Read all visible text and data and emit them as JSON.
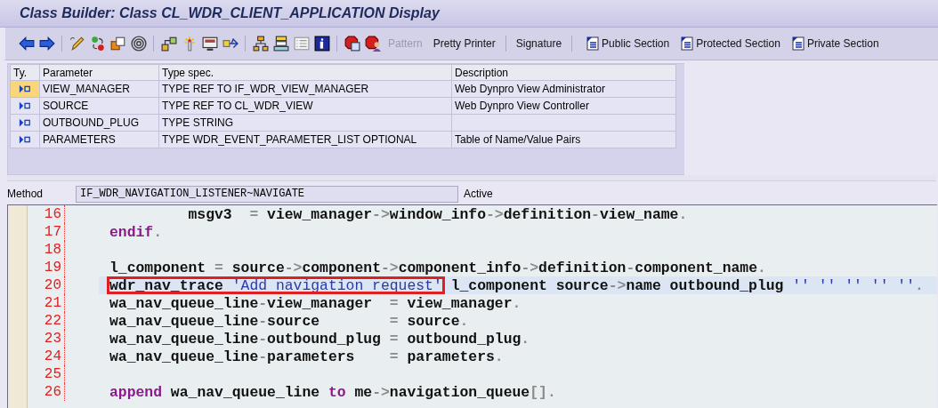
{
  "window": {
    "title": "Class Builder: Class CL_WDR_CLIENT_APPLICATION Display"
  },
  "toolbar": {
    "items": [
      {
        "kind": "icon"
      },
      {
        "kind": "icon"
      },
      {
        "kind": "separator"
      },
      {
        "kind": "icon"
      },
      {
        "kind": "icon"
      },
      {
        "kind": "icon"
      },
      {
        "kind": "icon"
      },
      {
        "kind": "separator"
      },
      {
        "kind": "icon"
      },
      {
        "kind": "icon"
      },
      {
        "kind": "icon"
      },
      {
        "kind": "icon"
      },
      {
        "kind": "separator"
      },
      {
        "kind": "icon"
      },
      {
        "kind": "icon"
      },
      {
        "kind": "icon"
      },
      {
        "kind": "icon"
      },
      {
        "kind": "separator"
      },
      {
        "kind": "icon"
      },
      {
        "kind": "icon"
      },
      {
        "kind": "text",
        "label": "Pattern",
        "disabled": true
      },
      {
        "kind": "text",
        "label": "Pretty Printer",
        "disabled": false
      },
      {
        "kind": "separator"
      },
      {
        "kind": "text",
        "label": "Signature",
        "disabled": false
      },
      {
        "kind": "separator"
      },
      {
        "kind": "section",
        "label": "Public Section",
        "disabled": false
      },
      {
        "kind": "section",
        "label": "Protected Section",
        "disabled": false
      },
      {
        "kind": "section",
        "label": "Private Section",
        "disabled": false
      }
    ]
  },
  "parameters": {
    "columns": [
      "Ty.",
      "Parameter",
      "Type spec.",
      "Description"
    ],
    "rows": [
      {
        "selected": true,
        "parameter": "VIEW_MANAGER",
        "type_spec": "TYPE REF TO IF_WDR_VIEW_MANAGER",
        "description": "Web Dynpro View Administrator"
      },
      {
        "selected": false,
        "parameter": "SOURCE",
        "type_spec": "TYPE REF TO CL_WDR_VIEW",
        "description": "Web Dynpro View Controller"
      },
      {
        "selected": false,
        "parameter": "OUTBOUND_PLUG",
        "type_spec": "TYPE STRING"
      },
      {
        "selected": false,
        "parameter": "PARAMETERS",
        "type_spec": "TYPE WDR_EVENT_PARAMETER_LIST OPTIONAL",
        "description": "Table of Name/Value Pairs"
      }
    ]
  },
  "method": {
    "label": "Method",
    "value": "IF_WDR_NAVIGATION_LISTENER~NAVIGATE",
    "status": "Active"
  },
  "editor": {
    "lines": [
      {
        "number": "16",
        "current": false,
        "tokens": [
          {
            "kind": "plain",
            "text": "         msgv3  "
          },
          {
            "kind": "op",
            "text": "="
          },
          {
            "kind": "plain",
            "text": " view_manager"
          },
          {
            "kind": "op",
            "text": "->"
          },
          {
            "kind": "plain",
            "text": "window_info"
          },
          {
            "kind": "op",
            "text": "->"
          },
          {
            "kind": "plain",
            "text": "definition"
          },
          {
            "kind": "op",
            "text": "-"
          },
          {
            "kind": "plain",
            "text": "view_name"
          },
          {
            "kind": "op",
            "text": "."
          }
        ]
      },
      {
        "number": "17",
        "current": false,
        "tokens": [
          {
            "kind": "keyword",
            "text": "endif"
          },
          {
            "kind": "op",
            "text": "."
          }
        ]
      },
      {
        "number": "18",
        "current": false
      },
      {
        "number": "19",
        "current": false,
        "tokens": [
          {
            "kind": "plain",
            "text": "l_component "
          },
          {
            "kind": "op",
            "text": "="
          },
          {
            "kind": "plain",
            "text": " source"
          },
          {
            "kind": "op",
            "text": "->"
          },
          {
            "kind": "plain",
            "text": "component"
          },
          {
            "kind": "op",
            "text": "->"
          },
          {
            "kind": "plain",
            "text": "component_info"
          },
          {
            "kind": "op",
            "text": "->"
          },
          {
            "kind": "plain",
            "text": "definition"
          },
          {
            "kind": "op",
            "text": "-"
          },
          {
            "kind": "plain",
            "text": "component_name"
          },
          {
            "kind": "op",
            "text": "."
          }
        ]
      },
      {
        "number": "20",
        "current": true,
        "tokens": [
          {
            "kind": "plain",
            "text": "wdr_nav_trace ",
            "boxed": true
          },
          {
            "kind": "string",
            "text": "'Add navigation request'",
            "boxed": true
          },
          {
            "kind": "plain",
            "text": " l_component source"
          },
          {
            "kind": "op",
            "text": "->"
          },
          {
            "kind": "plain",
            "text": "name outbound_plug "
          },
          {
            "kind": "string",
            "text": "'' '' '' '' ''"
          },
          {
            "kind": "op",
            "text": "."
          }
        ]
      },
      {
        "number": "21",
        "current": false,
        "tokens": [
          {
            "kind": "plain",
            "text": "wa_nav_queue_line"
          },
          {
            "kind": "op",
            "text": "-"
          },
          {
            "kind": "plain",
            "text": "view_manager  "
          },
          {
            "kind": "op",
            "text": "="
          },
          {
            "kind": "plain",
            "text": " view_manager"
          },
          {
            "kind": "op",
            "text": "."
          }
        ]
      },
      {
        "number": "22",
        "current": false,
        "tokens": [
          {
            "kind": "plain",
            "text": "wa_nav_queue_line"
          },
          {
            "kind": "op",
            "text": "-"
          },
          {
            "kind": "plain",
            "text": "source        "
          },
          {
            "kind": "op",
            "text": "="
          },
          {
            "kind": "plain",
            "text": " source"
          },
          {
            "kind": "op",
            "text": "."
          }
        ]
      },
      {
        "number": "23",
        "current": false,
        "tokens": [
          {
            "kind": "plain",
            "text": "wa_nav_queue_line"
          },
          {
            "kind": "op",
            "text": "-"
          },
          {
            "kind": "plain",
            "text": "outbound_plug "
          },
          {
            "kind": "op",
            "text": "="
          },
          {
            "kind": "plain",
            "text": " outbound_plug"
          },
          {
            "kind": "op",
            "text": "."
          }
        ]
      },
      {
        "number": "24",
        "current": false,
        "tokens": [
          {
            "kind": "plain",
            "text": "wa_nav_queue_line"
          },
          {
            "kind": "op",
            "text": "-"
          },
          {
            "kind": "plain",
            "text": "parameters    "
          },
          {
            "kind": "op",
            "text": "="
          },
          {
            "kind": "plain",
            "text": " parameters"
          },
          {
            "kind": "op",
            "text": "."
          }
        ]
      },
      {
        "number": "25",
        "current": false
      },
      {
        "number": "26",
        "current": false,
        "tokens": [
          {
            "kind": "keyword",
            "text": "append"
          },
          {
            "kind": "plain",
            "text": " wa_nav_queue_line "
          },
          {
            "kind": "keyword",
            "text": "to"
          },
          {
            "kind": "plain",
            "text": " me"
          },
          {
            "kind": "op",
            "text": "->"
          },
          {
            "kind": "plain",
            "text": "navigation_queue"
          },
          {
            "kind": "op",
            "text": "[]."
          }
        ]
      }
    ]
  }
}
